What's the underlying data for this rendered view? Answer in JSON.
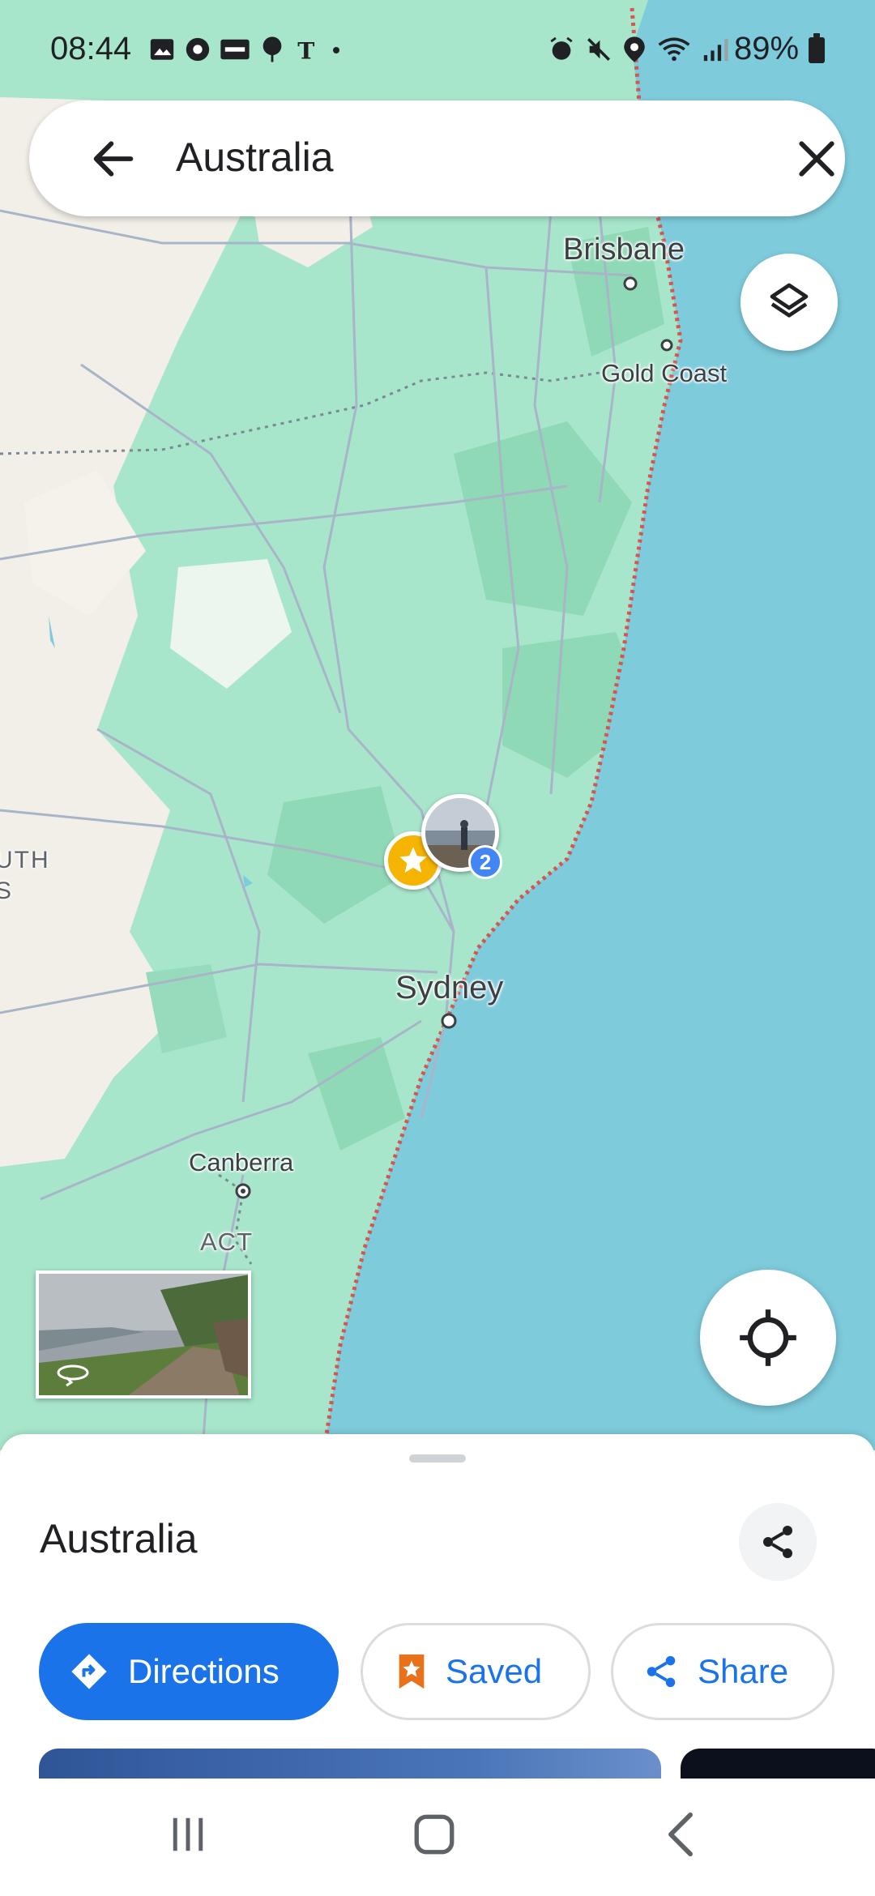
{
  "status_bar": {
    "time": "08:44",
    "battery": "89%",
    "left_icons": [
      "gallery-icon",
      "sync-icon",
      "news-icon",
      "tree-icon",
      "nyt-icon",
      "dot-icon"
    ],
    "right_icons": [
      "alarm-icon",
      "mute-icon",
      "location-pin-icon",
      "wifi-icon",
      "signal-icon",
      "battery-icon"
    ]
  },
  "search": {
    "query": "Australia",
    "back_icon": "arrow-left-icon",
    "clear_icon": "close-icon"
  },
  "map": {
    "labels": {
      "brisbane": "Brisbane",
      "gold_coast": "Gold Coast",
      "sydney": "Sydney",
      "canberra": "Canberra",
      "act": "ACT",
      "south_partial": "UTH\nS"
    },
    "photo_marker_count": "2",
    "colors": {
      "ocean": "#7ecbdc",
      "land": "#a8e6cc",
      "forest": "#8fd9b6",
      "desert": "#f2efe8",
      "coast_border": "#d9534f",
      "accent": "#1a73e8"
    }
  },
  "sheet": {
    "title": "Australia",
    "buttons": {
      "directions": "Directions",
      "saved": "Saved",
      "share": "Share"
    }
  },
  "nav": {
    "recents_icon": "recents-icon",
    "home_icon": "home-icon",
    "back_icon": "nav-back-icon"
  }
}
